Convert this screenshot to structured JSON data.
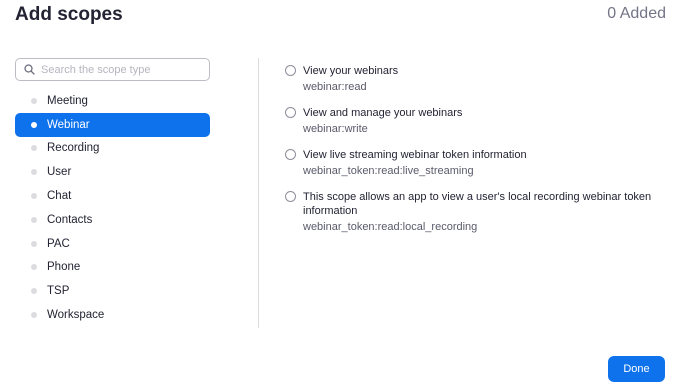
{
  "header": {
    "title": "Add scopes",
    "added_count": "0 Added"
  },
  "search": {
    "placeholder": "Search the scope type",
    "value": ""
  },
  "categories": [
    {
      "label": "Meeting",
      "selected": false
    },
    {
      "label": "Webinar",
      "selected": true
    },
    {
      "label": "Recording",
      "selected": false
    },
    {
      "label": "User",
      "selected": false
    },
    {
      "label": "Chat",
      "selected": false
    },
    {
      "label": "Contacts",
      "selected": false
    },
    {
      "label": "PAC",
      "selected": false
    },
    {
      "label": "Phone",
      "selected": false
    },
    {
      "label": "TSP",
      "selected": false
    },
    {
      "label": "Workspace",
      "selected": false
    }
  ],
  "scopes": [
    {
      "description": "View your webinars",
      "key": "webinar:read",
      "checked": false
    },
    {
      "description": "View and manage your webinars",
      "key": "webinar:write",
      "checked": false
    },
    {
      "description": "View live streaming webinar token information",
      "key": "webinar_token:read:live_streaming",
      "checked": false
    },
    {
      "description": "This scope allows an app to view a user's local recording webinar token information",
      "key": "webinar_token:read:local_recording",
      "checked": false
    }
  ],
  "footer": {
    "done_label": "Done"
  },
  "colors": {
    "accent": "#0e72ed",
    "text": "#232333",
    "muted": "#747487"
  }
}
